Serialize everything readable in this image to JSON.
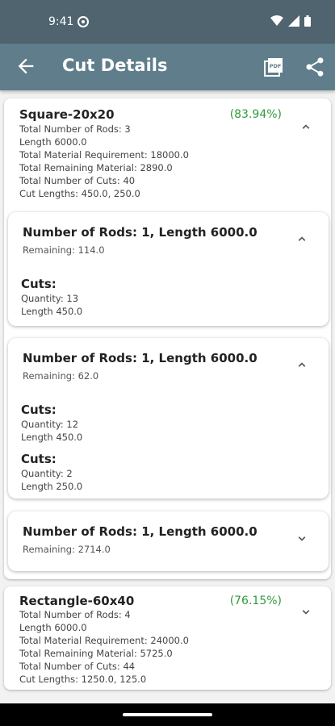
{
  "status_bar": {
    "time": "9:41"
  },
  "app_bar": {
    "title": "Cut Details",
    "pdf_icon": "pdf-icon",
    "share_icon": "share-icon"
  },
  "groups": [
    {
      "title": "Square-20x20",
      "percent": "(83.94%)",
      "stats": [
        "Total Number of Rods: 3",
        "Length 6000.0",
        "Total Material Requirement: 18000.0",
        "Total Remaining Material: 2890.0",
        "Total Number of Cuts: 40",
        "Cut Lengths: 450.0, 250.0"
      ],
      "rods": [
        {
          "title": "Number of Rods: 1, Length 6000.0",
          "remaining": "Remaining: 114.0",
          "cuts_label": "Cuts:",
          "cuts": [
            {
              "quantity": "Quantity: 13",
              "length": "Length 450.0"
            }
          ]
        },
        {
          "title": "Number of Rods: 1, Length 6000.0",
          "remaining": "Remaining: 62.0",
          "cuts_label": "Cuts:",
          "cuts": [
            {
              "quantity": "Quantity: 12",
              "length": "Length 450.0"
            },
            {
              "quantity": "Quantity: 2",
              "length": "Length 250.0"
            }
          ]
        },
        {
          "title": "Number of Rods: 1, Length 6000.0",
          "remaining": "Remaining: 2714.0"
        }
      ]
    },
    {
      "title": "Rectangle-60x40",
      "percent": "(76.15%)",
      "stats": [
        "Total Number of Rods: 4",
        "Length 6000.0",
        "Total Material Requirement: 24000.0",
        "Total Remaining Material: 5725.0",
        "Total Number of Cuts: 44",
        "Cut Lengths: 1250.0, 125.0"
      ]
    }
  ],
  "colors": {
    "app_bar": "#607d8b",
    "status_bar": "#4f646e",
    "percent": "#2e9b3c"
  }
}
